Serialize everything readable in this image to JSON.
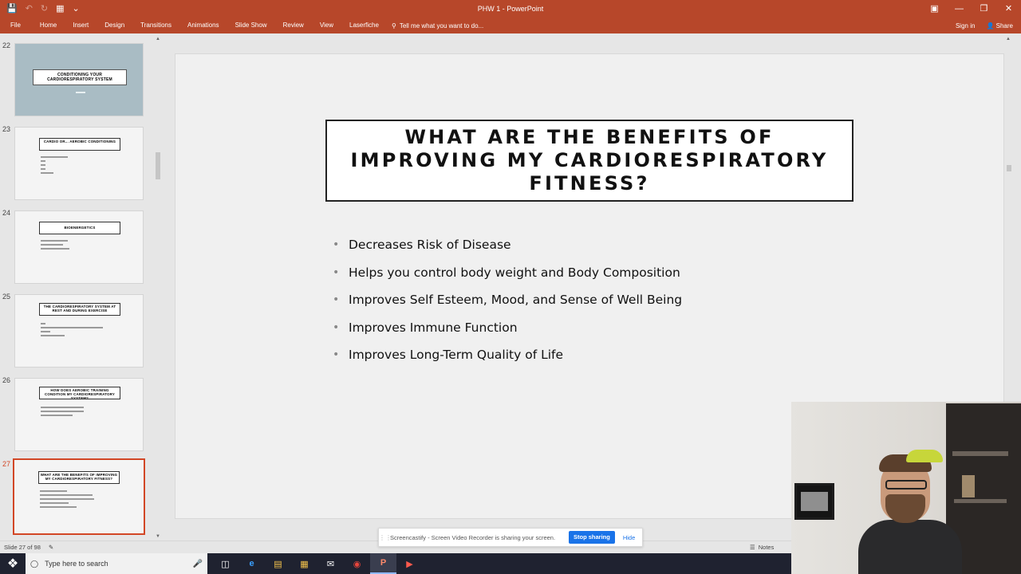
{
  "window": {
    "title": "PHW 1 - PowerPoint",
    "sign_in": "Sign in",
    "share": "Share"
  },
  "ribbon": {
    "tabs": [
      "File",
      "Home",
      "Insert",
      "Design",
      "Transitions",
      "Animations",
      "Slide Show",
      "Review",
      "View",
      "Laserfiche"
    ],
    "tell_me": "Tell me what you want to do..."
  },
  "thumbnails": [
    {
      "number": "22",
      "title": "CONDITIONING YOUR CARDIORESPIRATORY SYSTEM"
    },
    {
      "number": "23",
      "title": "CARDIO OR... AEROBIC CONDITIONING"
    },
    {
      "number": "24",
      "title": "BIOENERGETICS"
    },
    {
      "number": "25",
      "title": "THE CARDIORESPIRATORY SYSTEM AT REST AND DURING EXERCISE"
    },
    {
      "number": "26",
      "title": "HOW DOES AEROBIC TRAINING CONDITION MY CARDIORESPIRATORY SYSTEM?"
    },
    {
      "number": "27",
      "title": "WHAT ARE THE BENEFITS OF IMPROVING MY CARDIORESPIRATORY FITNESS?"
    }
  ],
  "slide": {
    "title": "WHAT ARE THE BENEFITS OF IMPROVING MY CARDIORESPIRATORY FITNESS?",
    "bullets": [
      "Decreases Risk of Disease",
      "Helps you control body weight and Body Composition",
      "Improves Self Esteem, Mood, and Sense of Well Being",
      "Improves Immune Function",
      "Improves Long-Term Quality of Life"
    ]
  },
  "status": {
    "slide_position": "Slide 27 of 98",
    "notes": "Notes"
  },
  "sharing": {
    "message": "Screencastify - Screen Video Recorder is sharing your screen.",
    "stop": "Stop sharing",
    "hide": "Hide"
  },
  "taskbar": {
    "search_placeholder": "Type here to search"
  },
  "colors": {
    "ribbon": "#b7472a",
    "selected_thumb": "#d24726",
    "share_button": "#1a73e8"
  }
}
